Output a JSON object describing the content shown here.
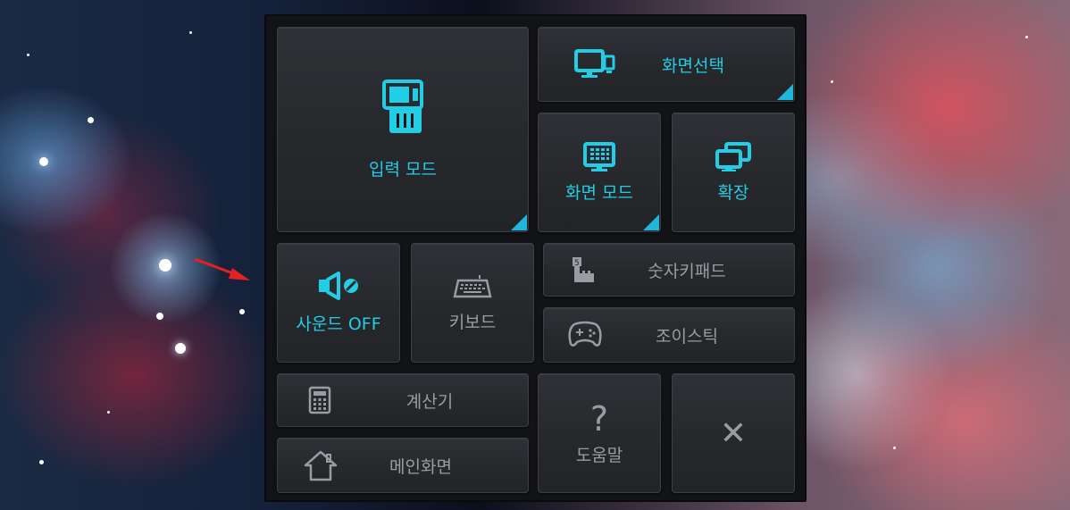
{
  "panel": {
    "input_mode": "입력 모드",
    "screen_select": "화면선택",
    "screen_mode": "화면 모드",
    "expand": "확장",
    "sound_off": "사운드 OFF",
    "keyboard": "키보드",
    "numpad": "숫자키패드",
    "joystick": "조이스틱",
    "calculator": "계산기",
    "help": "도움말",
    "main_screen": "메인화면",
    "close": "✕",
    "help_glyph": "?"
  },
  "icons": {
    "input_mode": "touch-tablet-icon",
    "screen_select": "dual-monitor-icon",
    "screen_mode": "monitor-grid-icon",
    "expand": "stacked-windows-icon",
    "sound_off": "speaker-off-icon",
    "keyboard": "keyboard-icon",
    "numpad": "numpad-hand-icon",
    "joystick": "gamepad-icon",
    "calculator": "calculator-icon",
    "main_screen": "home-icon",
    "help": "question-icon",
    "close": "close-icon"
  },
  "colors": {
    "accent": "#22cde6",
    "inactive": "#9a9ca2",
    "corner": "#1fb6d9"
  }
}
